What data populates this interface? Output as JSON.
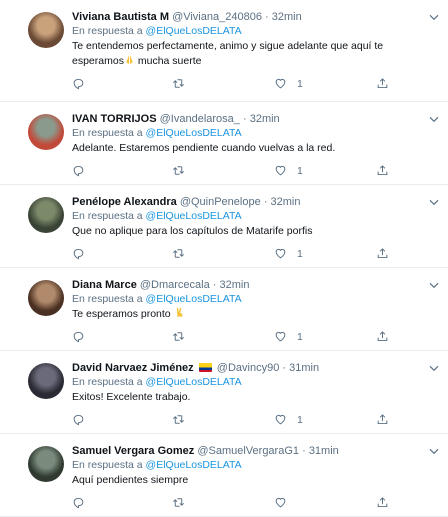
{
  "feed": {
    "tweets": [
      {
        "name": "Viviana Bautista M",
        "handle": "@Viviana_240806",
        "dot": "·",
        "time": "32min",
        "reply_prefix": "En respuesta a ",
        "reply_to": "@ElQueLosDELATA",
        "text": "Te entendemos perfectamente, animo y sigue adelante que aquí te esperamos",
        "text_after_emoji": " mucha suerte",
        "emoji": "praying-hands",
        "likes": "1",
        "avatar_colors": [
          "#c9a27c",
          "#6b4a35"
        ]
      },
      {
        "name": "IVAN TORRIJOS",
        "handle": "@Ivandelarosa_",
        "dot": "·",
        "time": "32min",
        "reply_prefix": "En respuesta a ",
        "reply_to": "@ElQueLosDELATA",
        "text": "Adelante. Estaremos pendiente cuando vuelvas a la red.",
        "likes": "1",
        "avatar_colors": [
          "#8a9a8c",
          "#c24a3a"
        ]
      },
      {
        "name": "Penélope Alexandra",
        "handle": "@QuinPenelope",
        "dot": "·",
        "time": "32min",
        "reply_prefix": "En respuesta a ",
        "reply_to": "@ElQueLosDELATA",
        "text": "Que no aplique para los capítulos de Matarife porfis",
        "likes": "1",
        "avatar_colors": [
          "#7c8a6a",
          "#3a4436"
        ]
      },
      {
        "name": "Diana Marce",
        "handle": "@Dmarcecala",
        "dot": "·",
        "time": "32min",
        "reply_prefix": "En respuesta a ",
        "reply_to": "@ElQueLosDELATA",
        "text": "Te esperamos pronto ",
        "emoji": "victory-hand",
        "likes": "1",
        "avatar_colors": [
          "#b08a6a",
          "#4a3022"
        ]
      },
      {
        "name": "David Narvaez Jiménez",
        "flag": "colombia-flag",
        "handle": "@Davincy90",
        "dot": "·",
        "time": "31min",
        "reply_prefix": "En respuesta a ",
        "reply_to": "@ElQueLosDELATA",
        "text": "Exitos! Excelente trabajo.",
        "likes": "1",
        "avatar_colors": [
          "#6a6a7a",
          "#2a2a34"
        ]
      },
      {
        "name": "Samuel Vergara Gomez",
        "handle": "@SamuelVergaraG1",
        "dot": "·",
        "time": "31min",
        "reply_prefix": "En respuesta a ",
        "reply_to": "@ElQueLosDELATA",
        "text": "Aquí pendientes siempre",
        "likes": "",
        "avatar_colors": [
          "#7a8a7c",
          "#303a30"
        ]
      }
    ]
  },
  "colors": {
    "link": "#1b95e0",
    "secondary_text": "#5b7083",
    "divider": "#e6ecf0"
  }
}
